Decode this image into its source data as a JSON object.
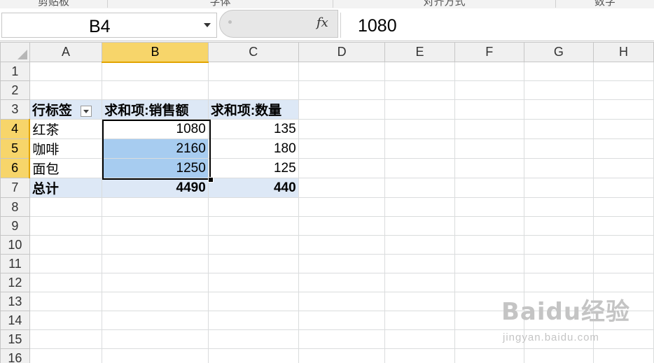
{
  "ribbon_groups": [
    "剪贴板",
    "字体",
    "对齐方式",
    "数字"
  ],
  "formula_bar": {
    "name_box": "B4",
    "fx_label": "fx",
    "formula": "1080"
  },
  "columns": [
    "A",
    "B",
    "C",
    "D",
    "E",
    "F",
    "G",
    "H"
  ],
  "rows": [
    "1",
    "2",
    "3",
    "4",
    "5",
    "6",
    "7",
    "8",
    "9",
    "10",
    "11",
    "12",
    "13",
    "14",
    "15",
    "16"
  ],
  "pivot": {
    "row_label_header": "行标签",
    "value_headers": [
      "求和项:销售额",
      "求和项:数量"
    ],
    "items": [
      {
        "label": "红茶",
        "sales": "1080",
        "qty": "135"
      },
      {
        "label": "咖啡",
        "sales": "2160",
        "qty": "180"
      },
      {
        "label": "面包",
        "sales": "1250",
        "qty": "125"
      }
    ],
    "total": {
      "label": "总计",
      "sales": "4490",
      "qty": "440"
    }
  },
  "selection": {
    "active_cell": "B4",
    "range": "B4:B6",
    "selected_column": "B",
    "selected_rows": [
      "4",
      "5",
      "6"
    ]
  },
  "watermark": {
    "logo": "Baidu经验",
    "sub": "jingyan.baidu.com"
  },
  "colors": {
    "selection_fill": "#a7ccf0",
    "pivot_header": "#dde8f6",
    "header_highlight": "#f7d56a"
  }
}
